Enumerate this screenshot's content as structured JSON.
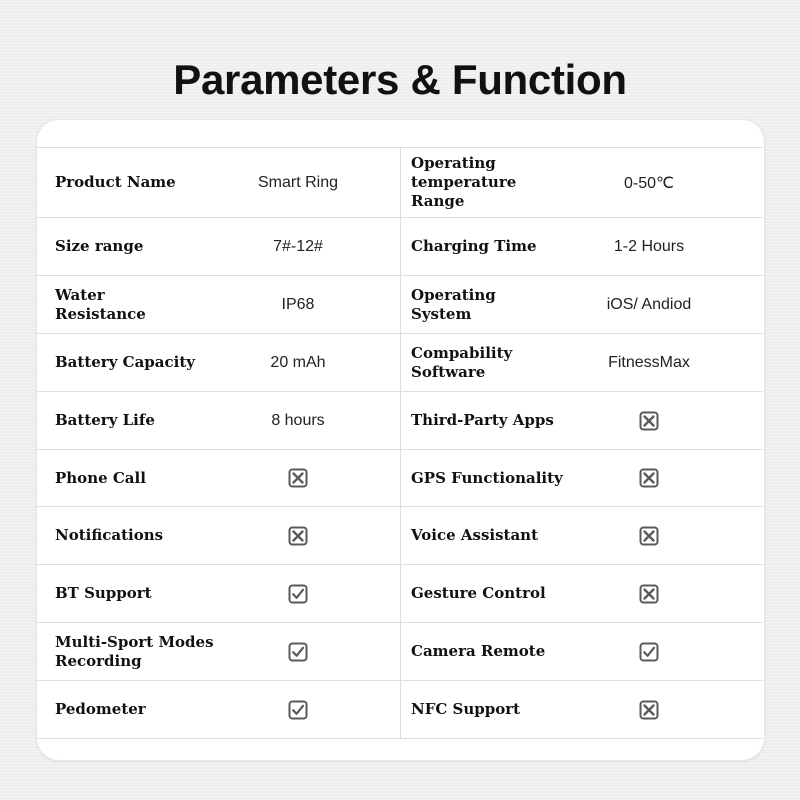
{
  "title": "Parameters & Function",
  "colors": {
    "background": "#eeeeee",
    "card": "#ffffff",
    "grid": "#dedede",
    "icon": "#5a5a5a",
    "text": "#111111"
  },
  "rows": [
    {
      "left": {
        "label": "Product Name",
        "type": "text",
        "value": "Smart Ring"
      },
      "right": {
        "label": "Operating\ntemperature\nRange",
        "type": "text",
        "value": "0-50℃"
      }
    },
    {
      "left": {
        "label": "Size range",
        "type": "text",
        "value": "7#-12#"
      },
      "right": {
        "label": "Charging Time",
        "type": "text",
        "value": "1-2 Hours"
      }
    },
    {
      "left": {
        "label": "Water\nResistance",
        "type": "text",
        "value": "IP68"
      },
      "right": {
        "label": "Operating\nSystem",
        "type": "text",
        "value": "iOS/ Andiod"
      }
    },
    {
      "left": {
        "label": "Battery Capacity",
        "type": "text",
        "value": "20 mAh"
      },
      "right": {
        "label": "Compability\nSoftware",
        "type": "text",
        "value": "FitnessMax"
      }
    },
    {
      "left": {
        "label": "Battery Life",
        "type": "text",
        "value": "8 hours"
      },
      "right": {
        "label": "Third-Party Apps",
        "type": "icon",
        "value": "x-box-icon"
      }
    },
    {
      "left": {
        "label": "Phone Call",
        "type": "icon",
        "value": "x-box-icon"
      },
      "right": {
        "label": "GPS Functionality",
        "type": "icon",
        "value": "x-box-icon"
      }
    },
    {
      "left": {
        "label": "Notifications",
        "type": "icon",
        "value": "x-box-icon"
      },
      "right": {
        "label": "Voice Assistant",
        "type": "icon",
        "value": "x-box-icon"
      }
    },
    {
      "left": {
        "label": "BT Support",
        "type": "icon",
        "value": "check-box-icon"
      },
      "right": {
        "label": "Gesture Control",
        "type": "icon",
        "value": "x-box-icon"
      }
    },
    {
      "left": {
        "label": "Multi-Sport Modes\nRecording",
        "type": "icon",
        "value": "check-box-icon"
      },
      "right": {
        "label": "Camera Remote",
        "type": "icon",
        "value": "check-box-icon"
      }
    },
    {
      "left": {
        "label": "Pedometer",
        "type": "icon",
        "value": "check-box-icon"
      },
      "right": {
        "label": "NFC Support",
        "type": "icon",
        "value": "x-box-icon"
      }
    }
  ]
}
